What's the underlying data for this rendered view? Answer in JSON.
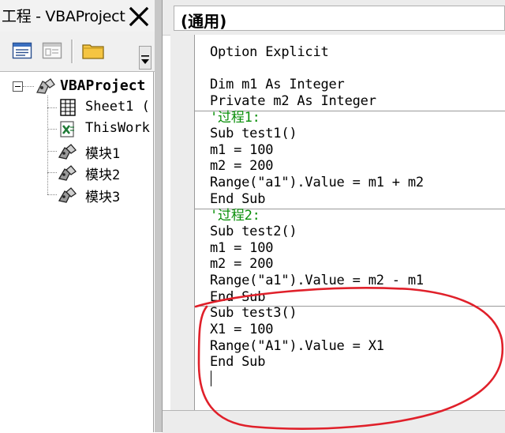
{
  "project_explorer": {
    "title": "工程 - VBAProject",
    "close_label": "✕",
    "toolbar": {
      "view_code_icon": "view-code-icon",
      "view_object_icon": "view-object-icon",
      "toggle_folders_icon": "folder-icon"
    },
    "tree": {
      "root": {
        "label": "VBAProject",
        "icon": "vba-project-icon",
        "expanded": true
      },
      "items": [
        {
          "label": "Sheet1 (",
          "icon": "worksheet-icon"
        },
        {
          "label": "ThisWork",
          "icon": "workbook-icon"
        },
        {
          "label": "模块1",
          "icon": "module-icon"
        },
        {
          "label": "模块2",
          "icon": "module-icon"
        },
        {
          "label": "模块3",
          "icon": "module-icon"
        }
      ]
    }
  },
  "code_window": {
    "object_dropdown": "(通用)",
    "lines": [
      {
        "text": "Option Explicit",
        "kind": "code"
      },
      {
        "text": "",
        "kind": "code"
      },
      {
        "text": "Dim m1 As Integer",
        "kind": "code"
      },
      {
        "text": "Private m2 As Integer",
        "kind": "code"
      },
      {
        "text": "'过程1:",
        "kind": "comment"
      },
      {
        "text": "Sub test1()",
        "kind": "code"
      },
      {
        "text": "m1 = 100",
        "kind": "code"
      },
      {
        "text": "m2 = 200",
        "kind": "code"
      },
      {
        "text": "Range(\"a1\").Value = m1 + m2",
        "kind": "code"
      },
      {
        "text": "End Sub",
        "kind": "code"
      },
      {
        "text": "'过程2:",
        "kind": "comment"
      },
      {
        "text": "Sub test2()",
        "kind": "code"
      },
      {
        "text": "m1 = 100",
        "kind": "code"
      },
      {
        "text": "m2 = 200",
        "kind": "code"
      },
      {
        "text": "Range(\"a1\").Value = m2 - m1",
        "kind": "code"
      },
      {
        "text": "End Sub",
        "kind": "code"
      },
      {
        "text": "Sub test3()",
        "kind": "code"
      },
      {
        "text": "X1 = 100",
        "kind": "code"
      },
      {
        "text": "Range(\"A1\").Value = X1",
        "kind": "code"
      },
      {
        "text": "End Sub",
        "kind": "code"
      }
    ],
    "procedure_separators_after_line": [
      3,
      9,
      15
    ]
  },
  "colors": {
    "comment": "#0a8f0a",
    "annotation": "#e0202a",
    "pane_bg": "#ececec"
  }
}
